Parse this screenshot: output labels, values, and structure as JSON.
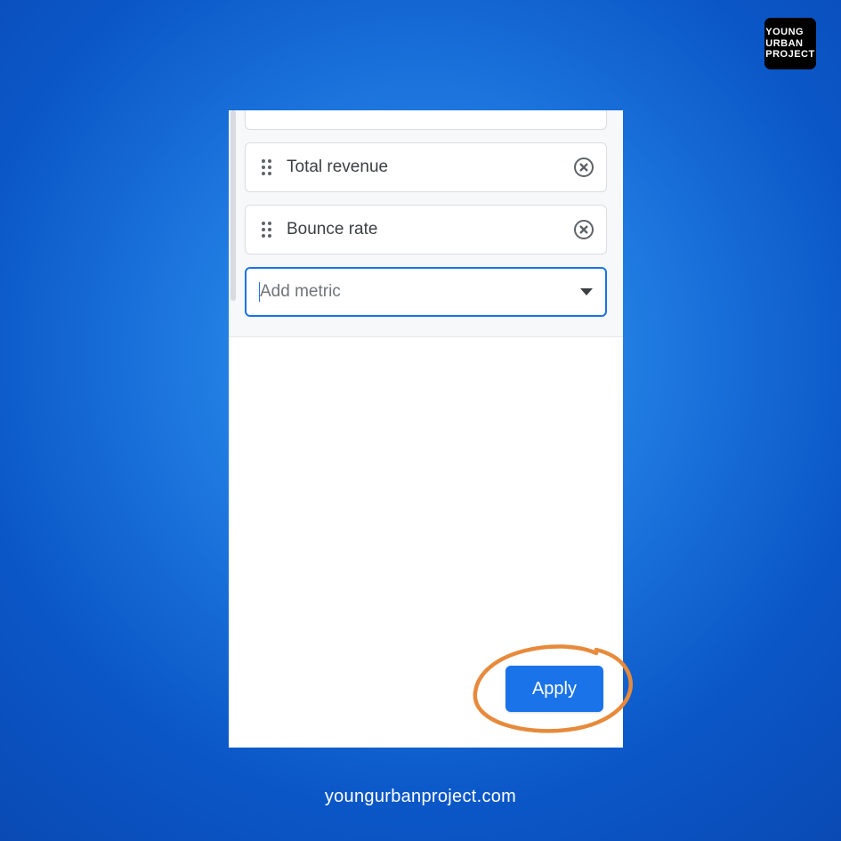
{
  "logo": {
    "line1": "YOUNG",
    "line2": "URBAN",
    "line3": "PROJECT"
  },
  "metrics": {
    "items": [
      {
        "label": "Total revenue"
      },
      {
        "label": "Bounce rate"
      }
    ],
    "add_placeholder": "Add metric"
  },
  "actions": {
    "apply_label": "Apply"
  },
  "footer": {
    "url": "youngurbanproject.com"
  },
  "colors": {
    "accent": "#1a73e8",
    "annotation": "#e78a3b"
  }
}
